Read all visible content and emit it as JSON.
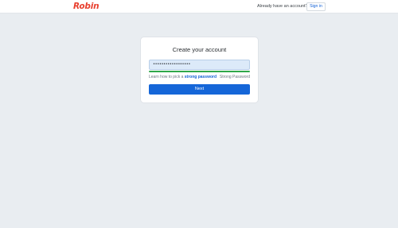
{
  "header": {
    "logo_text": "Robin",
    "already_text": "Already have an account?",
    "signin_label": "Sign in"
  },
  "form": {
    "title": "Create your account",
    "password_value": "••••••••••••••••••",
    "strength_fraction": 1.0,
    "hint_prefix": "Learn how to pick a ",
    "hint_link": "strong password",
    "strength_label": "Strong Password",
    "next_label": "Next"
  },
  "colors": {
    "brand": "#e8402f",
    "accent": "#1566d8",
    "strength_good": "#2fa84a"
  }
}
